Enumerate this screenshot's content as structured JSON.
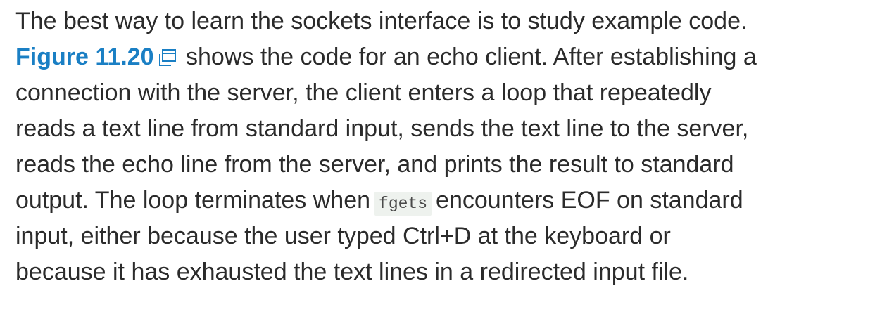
{
  "paragraph": {
    "line1": "The best way to learn the sockets interface is to study example code.",
    "figure_link": "Figure 11.20",
    "popup_icon": "popup-window-icon",
    "line2_after_link": "shows the code for an echo client. After establishing a",
    "line3": "connection with the server, the client enters a loop that repeatedly",
    "line4": "reads a text line from standard input, sends the text line to the server,",
    "line5": "reads the echo line from the server, and prints the result to standard",
    "line6_before_code": "output. The loop terminates when",
    "code_fgets": "fgets",
    "line6_after_code": "encounters EOF on standard",
    "line7": "input, either because the user typed Ctrl+D at the keyboard or",
    "line8": "because it has exhausted the text lines in a redirected input file."
  },
  "colors": {
    "text": "#2b2b2b",
    "link": "#1a7fc4",
    "code_background": "#eef2ee"
  }
}
